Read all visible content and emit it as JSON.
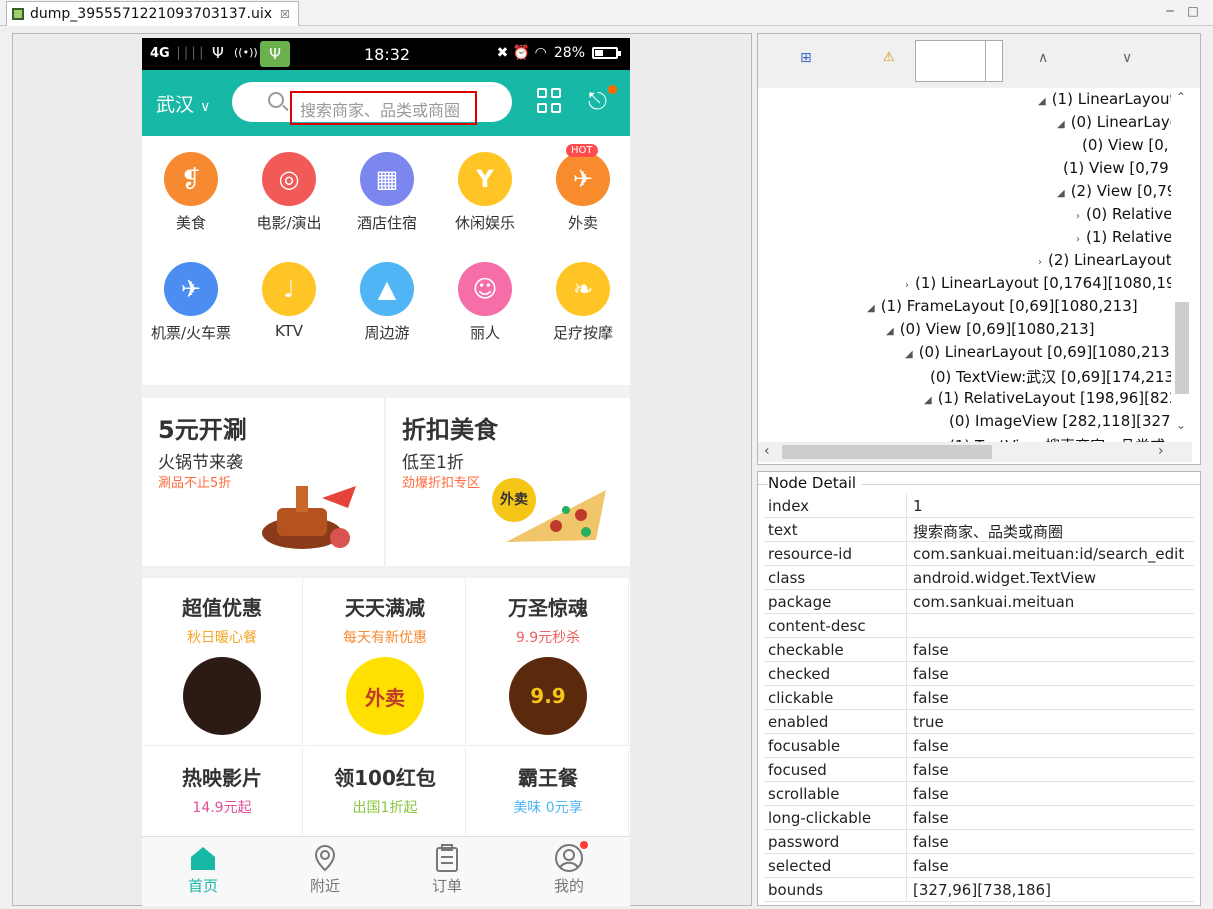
{
  "tab": {
    "title": "dump_3955571221093703137.uix",
    "close": "☒"
  },
  "phone": {
    "status": {
      "network": "4G",
      "signal": "││││",
      "usb": "Ψ",
      "hotspot": "((•))",
      "app": "Ψ",
      "time": "18:32",
      "icons": "✖ ⏰ ◠",
      "battery": "28%"
    },
    "header": {
      "city": "武汉",
      "city_arrow": "∨",
      "search_placeholder": "搜索商家、品类或商圈"
    },
    "categories": [
      {
        "label": "美食",
        "icon": "fork-knife-icon",
        "color": "#f78a30",
        "glyph": "❡"
      },
      {
        "label": "电影/演出",
        "icon": "film-reel-icon",
        "color": "#f25a58",
        "glyph": "◎"
      },
      {
        "label": "酒店住宿",
        "icon": "hotel-icon",
        "color": "#7b86ef",
        "glyph": "▦"
      },
      {
        "label": "休闲娱乐",
        "icon": "cocktail-icon",
        "color": "#ffc425",
        "glyph": "Y"
      },
      {
        "label": "外卖",
        "icon": "scooter-icon",
        "color": "#f88b2b",
        "glyph": "✈",
        "badge": "HOT"
      },
      {
        "label": "机票/火车票",
        "icon": "plane-train-icon",
        "color": "#4b8df0",
        "glyph": "✈"
      },
      {
        "label": "KTV",
        "icon": "microphone-icon",
        "color": "#ffc425",
        "glyph": "♩"
      },
      {
        "label": "周边游",
        "icon": "landscape-icon",
        "color": "#4fb5f4",
        "glyph": "▲"
      },
      {
        "label": "丽人",
        "icon": "woman-icon",
        "color": "#f56ea8",
        "glyph": "☺"
      },
      {
        "label": "足疗按摩",
        "icon": "footprint-icon",
        "color": "#ffc425",
        "glyph": "❧"
      }
    ],
    "promos": [
      {
        "title": "5元开涮",
        "subtitle": "火锅节来袭",
        "note": "涮品不止5折"
      },
      {
        "title": "折扣美食",
        "subtitle": "低至1折",
        "note": "劲爆折扣专区",
        "badge": "外卖"
      }
    ],
    "deals": [
      {
        "title": "超值优惠",
        "subtitle": "秋日暖心餐",
        "color": "#f4a623",
        "img_color": "#2b1b14",
        "img_text": ""
      },
      {
        "title": "天天满减",
        "subtitle": "每天有新优惠",
        "color": "#f78a30",
        "img_color": "#ffe000",
        "img_text": "外卖"
      },
      {
        "title": "万圣惊魂",
        "subtitle": "9.9元秒杀",
        "color": "#f06060",
        "img_color": "#5b2a0c",
        "img_text": "9.9"
      },
      {
        "title": "热映影片",
        "subtitle": "14.9元起",
        "color": "#e0509a"
      },
      {
        "title": "领100红包",
        "subtitle": "出国1折起",
        "color": "#8cc63f"
      },
      {
        "title": "霸王餐",
        "subtitle": "美味 0元享",
        "color": "#4fb5f4"
      }
    ],
    "nav": [
      {
        "label": "首页",
        "icon": "home-icon",
        "active": true
      },
      {
        "label": "附近",
        "icon": "location-pin-icon"
      },
      {
        "label": "订单",
        "icon": "clipboard-icon"
      },
      {
        "label": "我的",
        "icon": "user-icon"
      }
    ],
    "accent": "#17b8a6"
  },
  "toolbar": {
    "expand": "⊞",
    "warning": "⚠",
    "up": "∧",
    "down": "∨"
  },
  "tree": [
    {
      "text": "(1) LinearLayout",
      "indent": 15,
      "arrow": "◢"
    },
    {
      "text": "(0) LinearLayo",
      "indent": 16,
      "arrow": "◢"
    },
    {
      "text": "(0) View [0,",
      "indent": 17,
      "arrow": ""
    },
    {
      "text": "(1) View [0,79",
      "indent": 16,
      "arrow": ""
    },
    {
      "text": "(2) View [0,79",
      "indent": 16,
      "arrow": "◢"
    },
    {
      "text": "(0) Relative",
      "indent": 17,
      "arrow": "›"
    },
    {
      "text": "(1) Relative",
      "indent": 17,
      "arrow": "›"
    },
    {
      "text": "(2) LinearLayout",
      "indent": 15,
      "arrow": "›"
    },
    {
      "text": "(1) LinearLayout [0,1764][1080,192",
      "indent": 8,
      "arrow": "›"
    },
    {
      "text": "(1) FrameLayout [0,69][1080,213]",
      "indent": 6,
      "arrow": "◢"
    },
    {
      "text": "(0) View [0,69][1080,213]",
      "indent": 7,
      "arrow": "◢"
    },
    {
      "text": "(0) LinearLayout [0,69][1080,213]",
      "indent": 8,
      "arrow": "◢"
    },
    {
      "text": "(0) TextView:武汉 [0,69][174,213",
      "indent": 9,
      "arrow": ""
    },
    {
      "text": "(1) RelativeLayout [198,96][822,1",
      "indent": 9,
      "arrow": "◢"
    },
    {
      "text": "(0) ImageView [282,118][327,1",
      "indent": 10,
      "arrow": ""
    },
    {
      "text": "(1) TextView:搜索商家、品类或",
      "indent": 10,
      "arrow": ""
    }
  ],
  "detail": {
    "title": "Node Detail",
    "rows": [
      {
        "k": "index",
        "v": "1"
      },
      {
        "k": "text",
        "v": "搜索商家、品类或商圈"
      },
      {
        "k": "resource-id",
        "v": "com.sankuai.meituan:id/search_edit"
      },
      {
        "k": "class",
        "v": "android.widget.TextView"
      },
      {
        "k": "package",
        "v": "com.sankuai.meituan"
      },
      {
        "k": "content-desc",
        "v": ""
      },
      {
        "k": "checkable",
        "v": "false"
      },
      {
        "k": "checked",
        "v": "false"
      },
      {
        "k": "clickable",
        "v": "false"
      },
      {
        "k": "enabled",
        "v": "true"
      },
      {
        "k": "focusable",
        "v": "false"
      },
      {
        "k": "focused",
        "v": "false"
      },
      {
        "k": "scrollable",
        "v": "false"
      },
      {
        "k": "long-clickable",
        "v": "false"
      },
      {
        "k": "password",
        "v": "false"
      },
      {
        "k": "selected",
        "v": "false"
      },
      {
        "k": "bounds",
        "v": "[327,96][738,186]"
      }
    ]
  }
}
